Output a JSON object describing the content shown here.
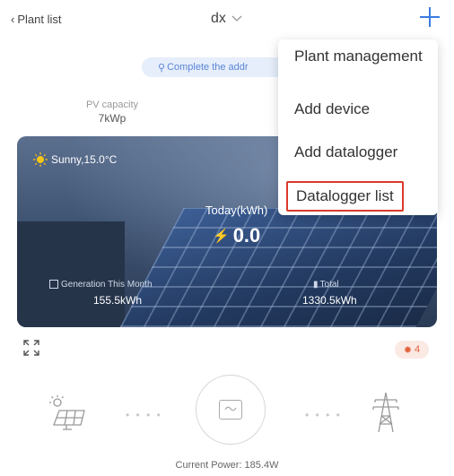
{
  "header": {
    "back_label": "Plant list",
    "title": "dx"
  },
  "notice": {
    "text": "Complete the addr"
  },
  "pv": {
    "label": "PV capacity",
    "value": "7kWp"
  },
  "banner": {
    "weather": "Sunny,15.0°C",
    "today_label": "Today(kWh)",
    "today_value": "0.0",
    "generation_label": "Generation This Month",
    "generation_value": "155.5kWh",
    "total_label": "Total",
    "total_value": "1330.5kWh"
  },
  "menu": {
    "items": [
      "Plant management",
      "Add device",
      "Add datalogger",
      "Datalogger list"
    ]
  },
  "alarm": {
    "count": "4"
  },
  "flow": {
    "current_power": "Current Power: 185.4W"
  },
  "colors": {
    "accent": "#3a7be0",
    "highlight_border": "#d93a2b",
    "alarm": "#e0623a"
  }
}
